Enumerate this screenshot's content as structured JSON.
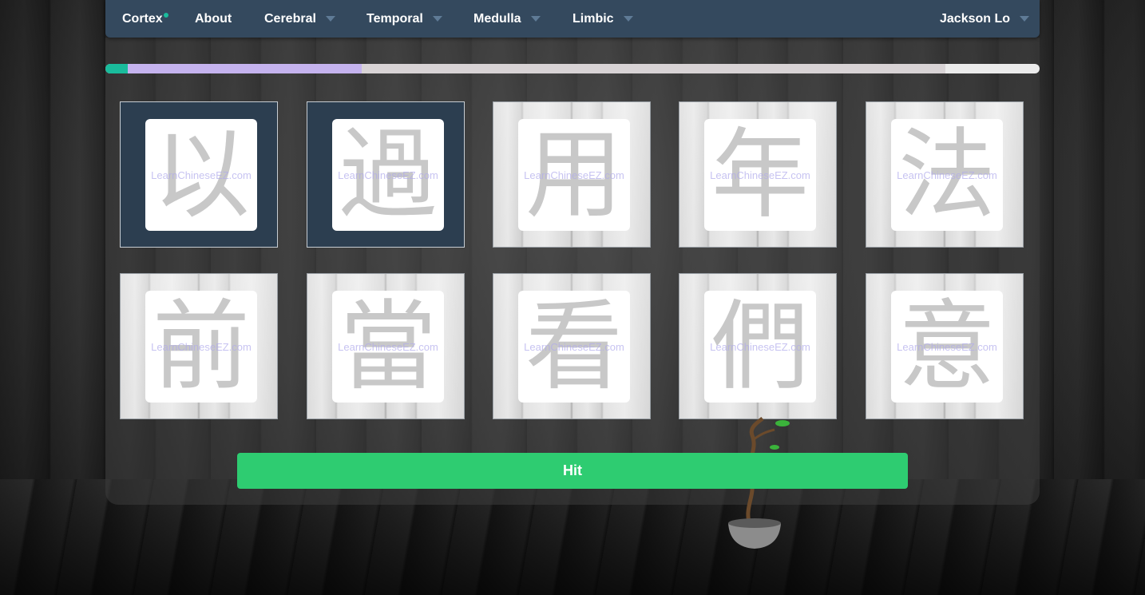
{
  "navbar": {
    "brand": "Cortex",
    "items": [
      {
        "label": "About",
        "dropdown": false
      },
      {
        "label": "Cerebral",
        "dropdown": true
      },
      {
        "label": "Temporal",
        "dropdown": true
      },
      {
        "label": "Medulla",
        "dropdown": true
      },
      {
        "label": "Limbic",
        "dropdown": true
      }
    ],
    "user": "Jackson Lo"
  },
  "progress": {
    "segments": [
      {
        "name": "completed",
        "color": "#1abc9c",
        "fraction": 0.024
      },
      {
        "name": "current",
        "color": "#c5b3ee",
        "fraction": 0.25
      },
      {
        "name": "remaining",
        "color": "#d8d3d5",
        "fraction": 0.625
      }
    ]
  },
  "cards": [
    {
      "character": "以",
      "selected": true
    },
    {
      "character": "過",
      "selected": true
    },
    {
      "character": "用",
      "selected": false
    },
    {
      "character": "年",
      "selected": false
    },
    {
      "character": "法",
      "selected": false
    },
    {
      "character": "前",
      "selected": false
    },
    {
      "character": "當",
      "selected": false
    },
    {
      "character": "看",
      "selected": false
    },
    {
      "character": "們",
      "selected": false
    },
    {
      "character": "意",
      "selected": false
    }
  ],
  "watermark": "LearnChineseEZ.com",
  "hit_button": {
    "label": "Hit"
  },
  "colors": {
    "navbar": "#34495e",
    "accent": "#1abc9c",
    "button": "#2ecc71",
    "selected_card": "#2c3e50"
  },
  "icons": [
    "caret-down-icon",
    "status-dot-icon",
    "bonsai-plant"
  ]
}
